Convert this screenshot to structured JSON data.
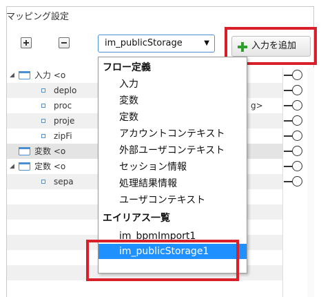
{
  "panel": {
    "title": "マッピング設定"
  },
  "toolbar": {
    "add_icon": "plus-icon",
    "remove_icon": "minus-icon",
    "select_value": "im_publicStorage",
    "select_arrow": "▼",
    "add_input_label": "入力を追加",
    "add_input_icon": "green-plus-icon"
  },
  "tree": {
    "rows": [
      {
        "label": "入力 <o",
        "expand": "◢"
      },
      {
        "label": "deplo"
      },
      {
        "label": "proc",
        "suffix": "g>"
      },
      {
        "label": "proje"
      },
      {
        "label": "zipFi"
      },
      {
        "label": "変数 <o"
      },
      {
        "label": "定数 <o",
        "expand": "◢"
      },
      {
        "label": "sepa"
      }
    ]
  },
  "dropdown": {
    "group_flow": "フロー定義",
    "items": [
      "入力",
      "変数",
      "定数",
      "アカウントコンテキスト",
      "外部ユーザコンテキスト",
      "セッション情報",
      "処理結果情報",
      "ユーザコンテキスト"
    ],
    "group_alias": "エイリアス一覧",
    "alias_items": [
      "im_bpmImport1",
      "im_publicStorage1"
    ]
  },
  "colors": {
    "highlight": "#1e90ff",
    "annotation": "#d81f2a",
    "add_icon": "#2e9e2e"
  }
}
